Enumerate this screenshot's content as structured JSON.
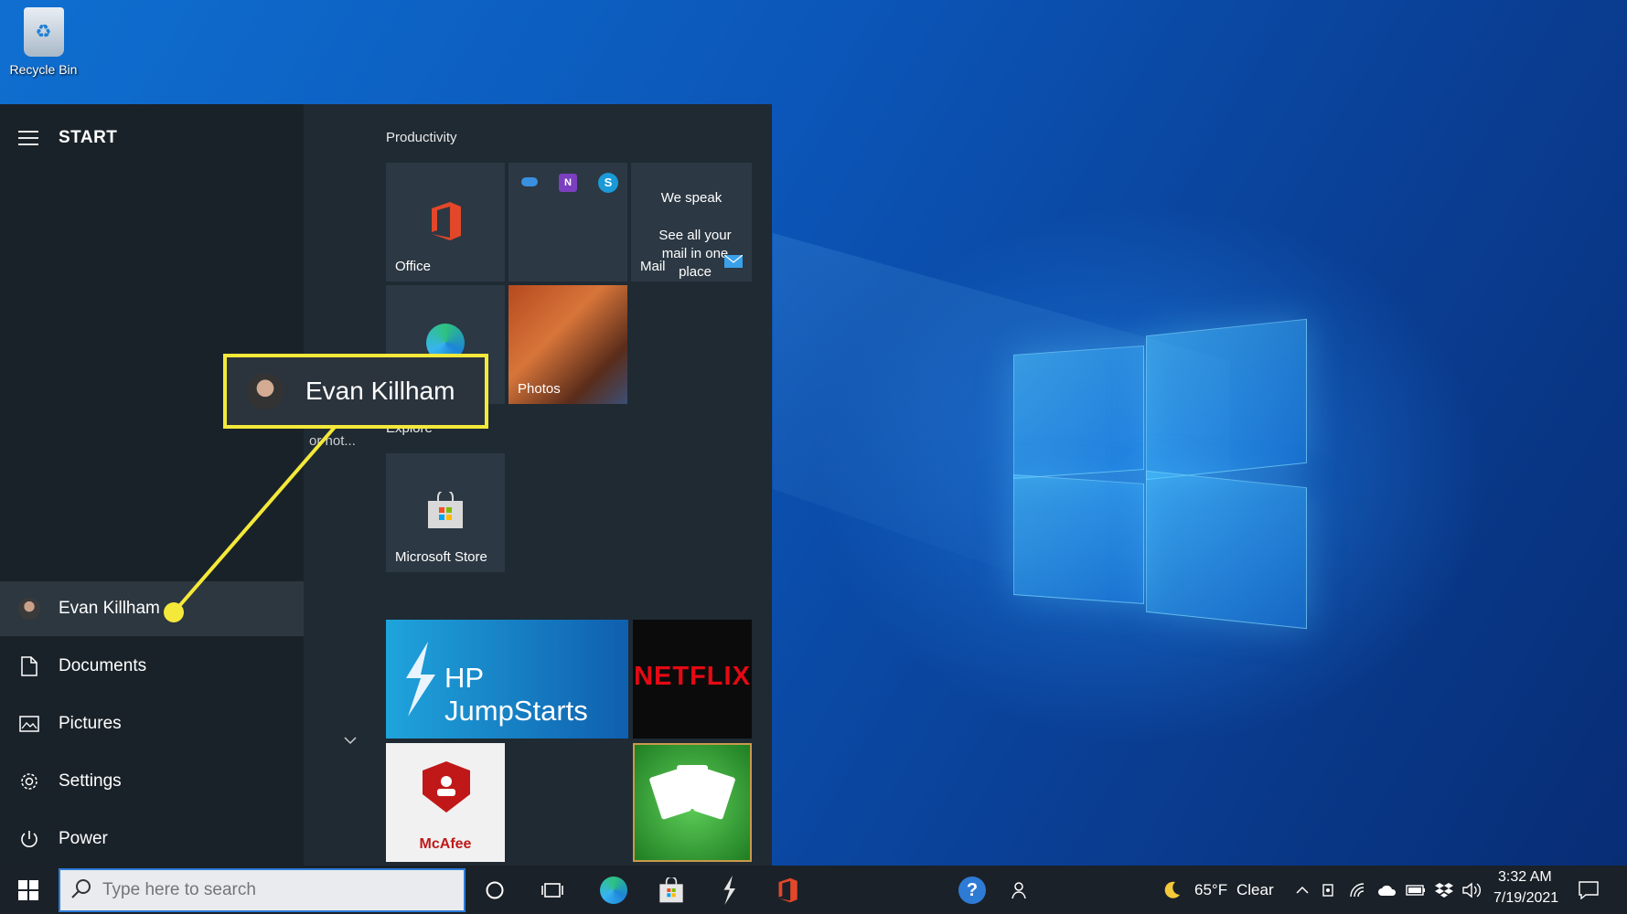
{
  "desktop": {
    "icons": [
      {
        "label": "Recycle Bin",
        "icon": "recycle-bin-icon"
      }
    ]
  },
  "start_menu": {
    "title": "START",
    "rail": {
      "user": "Evan Killham",
      "items": [
        {
          "label": "Documents",
          "icon": "document-icon"
        },
        {
          "label": "Pictures",
          "icon": "pictures-icon"
        },
        {
          "label": "Settings",
          "icon": "gear-icon"
        },
        {
          "label": "Power",
          "icon": "power-icon"
        }
      ]
    },
    "groups": {
      "productivity": "Productivity",
      "explore": "Explore"
    },
    "tiles": {
      "office": "Office",
      "mail": {
        "headline": "We speak",
        "body": "See all your mail in one place",
        "label": "Mail"
      },
      "photos": "Photos",
      "store": "Microsoft Store",
      "hp": "HP JumpStarts",
      "netflix": "NETFLIX",
      "mcafee": "McAfee",
      "hidden_label_fragment": "or hot..."
    }
  },
  "callout": {
    "name": "Evan Killham",
    "highlight_color": "#f4e93a"
  },
  "taskbar": {
    "search_placeholder": "Type here to search",
    "weather": {
      "temp": "65°F",
      "condition": "Clear"
    },
    "clock": {
      "time": "3:32 AM",
      "date": "7/19/2021"
    }
  },
  "colors": {
    "accent": "#2e7bd6",
    "start_bg": "#1f2a33",
    "callout_yellow": "#f4e93a"
  }
}
